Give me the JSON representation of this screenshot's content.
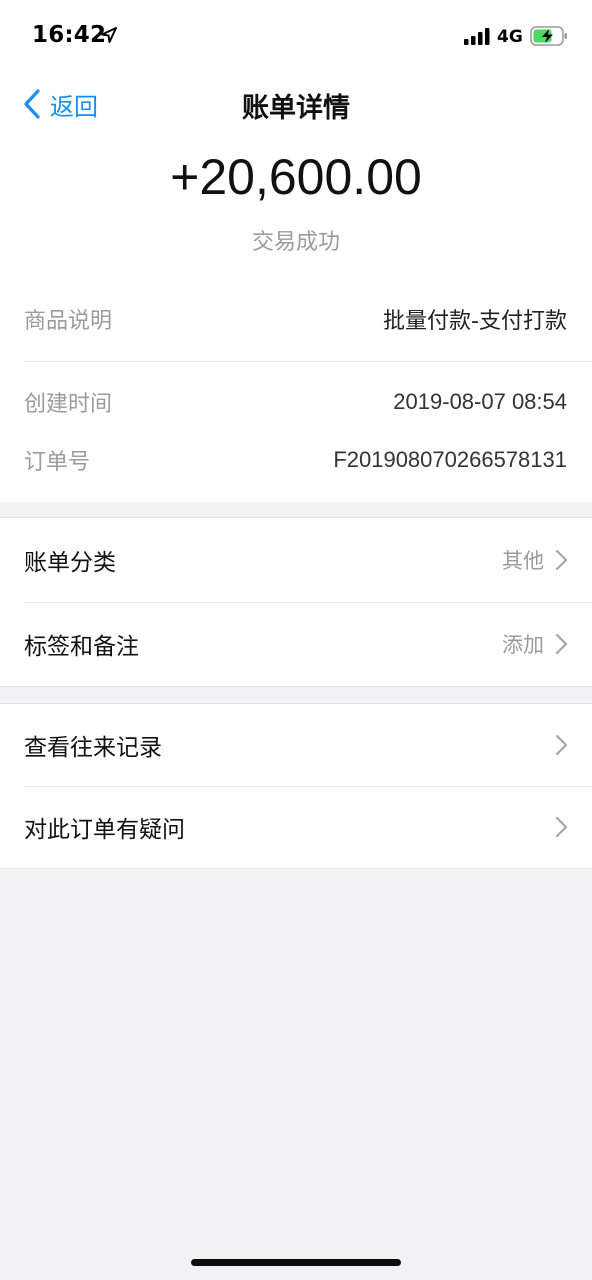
{
  "status_bar": {
    "time": "16:42",
    "network": "4G"
  },
  "nav": {
    "back_label": "返回",
    "title": "账单详情"
  },
  "summary": {
    "amount": "+20,600.00",
    "status": "交易成功"
  },
  "details": {
    "product": {
      "label": "商品说明",
      "value": "批量付款-支付打款"
    },
    "created": {
      "label": "创建时间",
      "value": "2019-08-07 08:54"
    },
    "order_no": {
      "label": "订单号",
      "value": "F201908070266578131"
    }
  },
  "group1": {
    "category": {
      "label": "账单分类",
      "value": "其他"
    },
    "tags": {
      "label": "标签和备注",
      "value": "添加"
    }
  },
  "group2": {
    "history": {
      "label": "查看往来记录"
    },
    "question": {
      "label": "对此订单有疑问"
    }
  },
  "colors": {
    "accent": "#1a8ef0",
    "battery_fill": "#4cd964",
    "muted_text": "#9b9b9b",
    "background": "#f2f2f6"
  },
  "icons": {
    "location": "location-arrow-icon",
    "signal": "cellular-signal-icon",
    "battery": "battery-charging-icon",
    "back": "chevron-left-icon",
    "row_disclosure": "chevron-right-icon"
  }
}
